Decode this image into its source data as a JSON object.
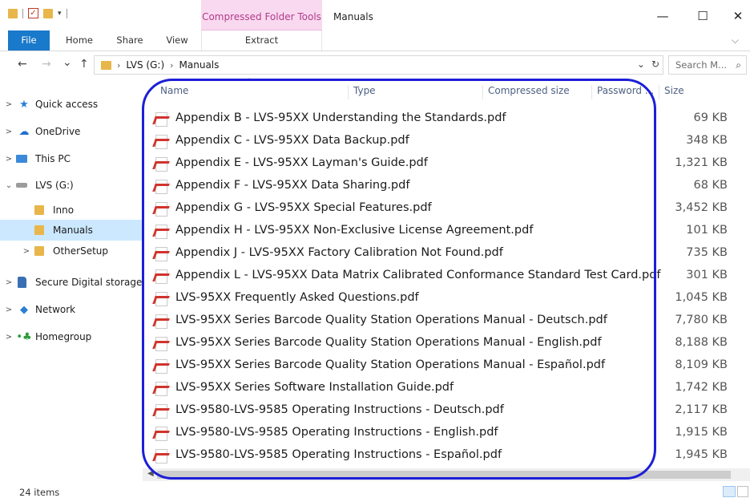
{
  "window": {
    "context_tab": "Compressed Folder Tools",
    "title": "Manuals",
    "minimize_glyph": "—",
    "maximize_glyph": "☐",
    "close_glyph": "✕"
  },
  "ribbon": {
    "tabs": [
      "File",
      "Home",
      "Share",
      "View",
      "Extract"
    ],
    "expand_glyph": "⌵"
  },
  "address": {
    "back_glyph": "←",
    "forward_glyph": "→",
    "recent_glyph": "⌄",
    "up_glyph": "↑",
    "breadcrumb": [
      "LVS (G:)",
      "Manuals"
    ],
    "dropdown_glyph": "⌄",
    "refresh_glyph": "↻"
  },
  "search": {
    "placeholder": "Search M...",
    "icon": "search-icon"
  },
  "nav": {
    "items": [
      {
        "label": "Quick access",
        "arrow": ">",
        "icon": "quick-access-star-icon"
      },
      {
        "label": "OneDrive",
        "arrow": ">",
        "icon": "onedrive-cloud-icon"
      },
      {
        "label": "This PC",
        "arrow": ">",
        "icon": "computer-icon"
      },
      {
        "label": "LVS (G:)",
        "arrow": "⌄",
        "icon": "drive-icon"
      },
      {
        "label": "Inno",
        "arrow": "",
        "icon": "folder-icon"
      },
      {
        "label": "Manuals",
        "arrow": "",
        "icon": "folder-icon"
      },
      {
        "label": "OtherSetup",
        "arrow": ">",
        "icon": "folder-icon"
      },
      {
        "label": "Secure Digital storage",
        "arrow": ">",
        "icon": "sd-card-icon"
      },
      {
        "label": "Network",
        "arrow": ">",
        "icon": "network-icon"
      },
      {
        "label": "Homegroup",
        "arrow": ">",
        "icon": "homegroup-icon"
      }
    ]
  },
  "columns": [
    "Name",
    "Type",
    "Compressed size",
    "Password ...",
    "Size"
  ],
  "files": [
    {
      "name": "Appendix B - LVS-95XX Understanding the Standards.pdf",
      "size": "69 KB"
    },
    {
      "name": "Appendix C - LVS-95XX Data Backup.pdf",
      "size": "348 KB"
    },
    {
      "name": "Appendix E - LVS-95XX Layman's Guide.pdf",
      "size": "1,321 KB"
    },
    {
      "name": "Appendix F - LVS-95XX Data Sharing.pdf",
      "size": "68 KB"
    },
    {
      "name": "Appendix G - LVS-95XX Special Features.pdf",
      "size": "3,452 KB"
    },
    {
      "name": "Appendix H - LVS-95XX Non-Exclusive License Agreement.pdf",
      "size": "101 KB"
    },
    {
      "name": "Appendix J - LVS-95XX Factory Calibration Not Found.pdf",
      "size": "735 KB"
    },
    {
      "name": "Appendix L - LVS-95XX Data Matrix Calibrated Conformance Standard Test Card.pdf",
      "size": "301 KB"
    },
    {
      "name": "LVS-95XX Frequently Asked Questions.pdf",
      "size": "1,045 KB"
    },
    {
      "name": "LVS-95XX Series Barcode Quality Station Operations Manual - Deutsch.pdf",
      "size": "7,780 KB"
    },
    {
      "name": "LVS-95XX Series Barcode Quality Station Operations Manual - English.pdf",
      "size": "8,188 KB"
    },
    {
      "name": "LVS-95XX Series Barcode Quality Station Operations Manual - Español.pdf",
      "size": "8,109 KB"
    },
    {
      "name": "LVS-95XX Series Software Installation Guide.pdf",
      "size": "1,742 KB"
    },
    {
      "name": "LVS-9580-LVS-9585 Operating Instructions - Deutsch.pdf",
      "size": "2,117 KB"
    },
    {
      "name": "LVS-9580-LVS-9585 Operating Instructions - English.pdf",
      "size": "1,915 KB"
    },
    {
      "name": "LVS-9580-LVS-9585 Operating Instructions - Español.pdf",
      "size": "1,945 KB"
    }
  ],
  "status": {
    "item_count": "24 items"
  },
  "colors": {
    "accent": "#1979ca",
    "selection": "#cce8ff",
    "highlight_ring": "#1c1fd6",
    "context_tab": "#f9d9ef"
  }
}
